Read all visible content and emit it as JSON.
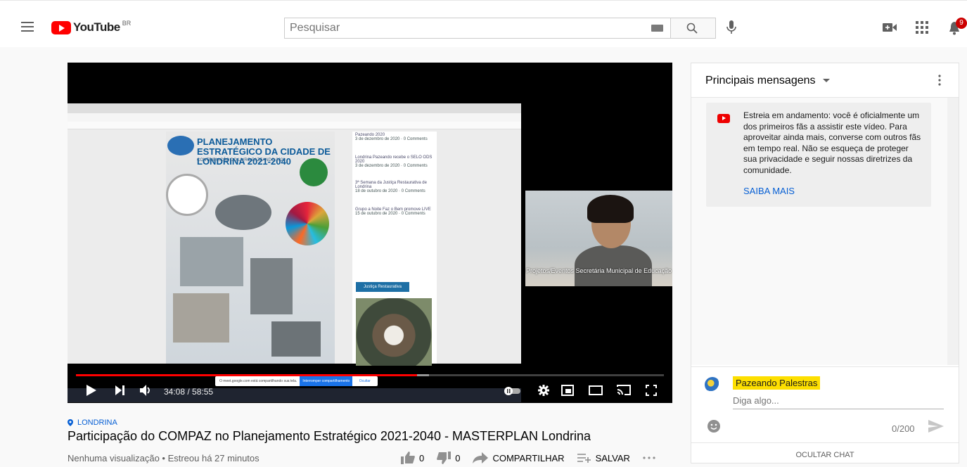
{
  "header": {
    "logo_text": "YouTube",
    "country_code": "BR",
    "search_placeholder": "Pesquisar",
    "notification_count": "9"
  },
  "player": {
    "current_time": "34:08",
    "duration": "58:55",
    "time_display": "34:08 / 58:55",
    "played_fraction": 0.58,
    "loaded_fraction": 0.6,
    "camera_label": "Projetos/Eventos Secretária Municipal de Educação",
    "shared_screen": {
      "poster_title": "PLANEJAMENTO ESTRATÉGICO DA CIDADE DE LONDRINA 2021-2040",
      "poster_subtitle": "CONTRIBUIÇÃO DO LIVRO PAZEANDO 2021",
      "posts": [
        {
          "title": "Pazeando 2020",
          "meta": "3 de dezembro de 2020 · 0 Comments"
        },
        {
          "title": "Londrina Pazeando recebe o SELO ODS 2020",
          "meta": "3 de dezembro de 2020 · 0 Comments"
        },
        {
          "title": "3ª Semana da Justiça Restaurativa de Londrina",
          "meta": "18 de outubro de 2020 · 0 Comments"
        },
        {
          "title": "Grupo a Noite Faz o Bem promove LIVE",
          "meta": "15 de outubro de 2020 · 0 Comments"
        }
      ],
      "category_button": "Justiça Restaurativa",
      "share_message": "O meet.google.com está compartilhando sua tela.",
      "share_stop": "Interromper compartilhamento",
      "share_hide": "Ocultar"
    }
  },
  "video": {
    "location": "LONDRINA",
    "title": "Participação do COMPAZ no Planejamento Estratégico 2021-2040 - MASTERPLAN Londrina",
    "views_line": "Nenhuma visualização • Estreou há 27 minutos",
    "likes": "0",
    "dislikes": "0",
    "share_label": "COMPARTILHAR",
    "save_label": "SALVAR"
  },
  "chat": {
    "header_title": "Principais mensagens",
    "notice_text": "Estreia em andamento: você é oficialmente um dos primeiros fãs a assistir este vídeo. Para aproveitar ainda mais, converse com outros fãs em tempo real. Não se esqueça de proteger sua privacidade e seguir nossas diretrizes da comunidade.",
    "notice_link": "SAIBA MAIS",
    "channel_name": "Pazeando Palestras",
    "input_placeholder": "Diga algo...",
    "char_counter": "0/200",
    "hide_chat": "OCULTAR CHAT"
  }
}
